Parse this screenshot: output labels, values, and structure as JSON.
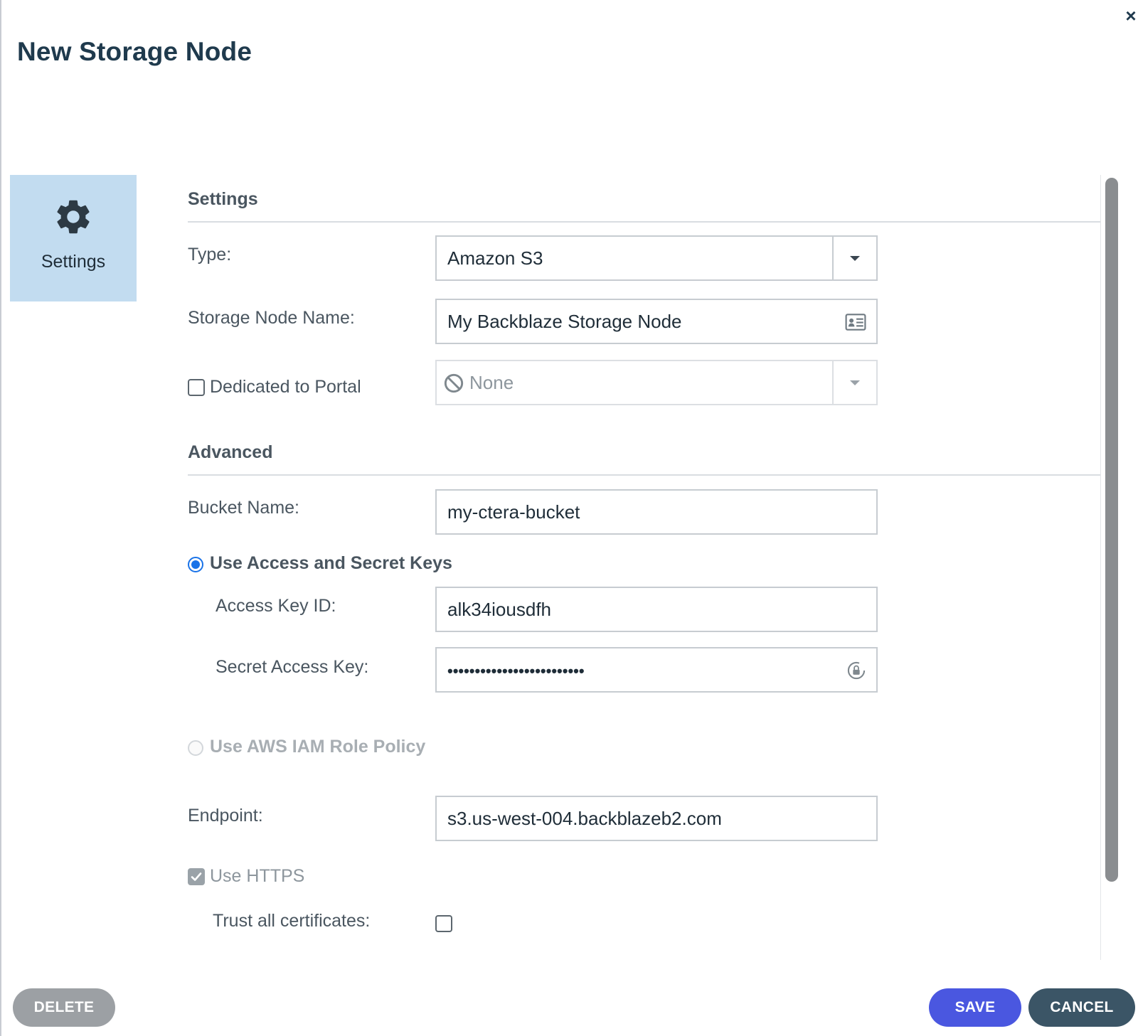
{
  "dialog": {
    "title": "New Storage Node",
    "close_glyph": "×",
    "close_icon": "close-icon"
  },
  "sidebar": {
    "items": [
      {
        "label": "Settings",
        "icon": "gear-icon",
        "selected": true
      }
    ]
  },
  "settings_section": {
    "title": "Settings",
    "type_label": "Type:",
    "type_value": "Amazon S3",
    "name_label": "Storage Node Name:",
    "name_value": "My Backblaze Storage Node",
    "name_icon": "id-card-icon",
    "dedicated_label": "Dedicated to Portal",
    "dedicated_checked": false,
    "portal_value": "None",
    "portal_icon": "no-entry-icon"
  },
  "advanced_section": {
    "title": "Advanced",
    "bucket_label": "Bucket Name:",
    "bucket_value": "my-ctera-bucket",
    "use_keys_label": "Use Access and Secret Keys",
    "use_keys_selected": true,
    "access_key_label": "Access Key ID:",
    "access_key_value": "alk34iousdfh",
    "secret_key_label": "Secret Access Key:",
    "secret_key_value": "•••••••••••••••••••••••••",
    "secret_key_icon": "lock-reveal-icon",
    "iam_label": "Use AWS IAM Role Policy",
    "iam_selected": false,
    "endpoint_label": "Endpoint:",
    "endpoint_value": "s3.us-west-004.backblazeb2.com",
    "https_label": "Use HTTPS",
    "https_checked": true,
    "trust_label": "Trust all certificates:",
    "trust_checked": false
  },
  "footer": {
    "delete_label": "DELETE",
    "save_label": "SAVE",
    "cancel_label": "CANCEL"
  },
  "colors": {
    "save": "#4a57e0",
    "cancel": "#3b5566",
    "delete": "#9ca0a4",
    "selected_tab": "#c2dcf0",
    "radio_accent": "#1a73e8"
  }
}
